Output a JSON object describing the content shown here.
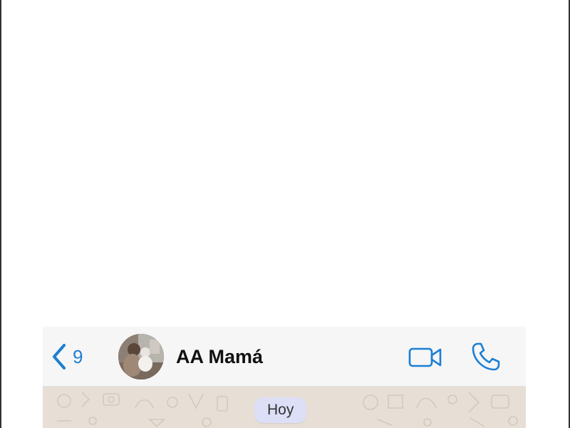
{
  "header": {
    "back_count": "9",
    "contact_name": "AA Mamá"
  },
  "chat": {
    "date_label": "Hoy"
  },
  "icons": {
    "back": "chevron-left-icon",
    "video": "video-camera-icon",
    "call": "phone-icon"
  },
  "colors": {
    "accent": "#1b7fd4",
    "header_bg": "#f6f6f6",
    "wallpaper_bg": "#e7dfd5",
    "date_pill_bg": "#dcdff6"
  }
}
